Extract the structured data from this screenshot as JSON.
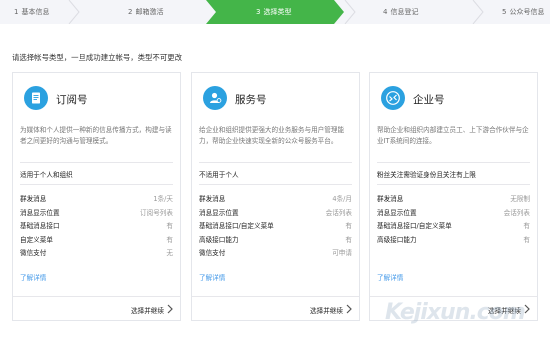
{
  "steps": [
    {
      "num": "1",
      "label": "基本信息"
    },
    {
      "num": "2",
      "label": "邮箱激活"
    },
    {
      "num": "3",
      "label": "选择类型"
    },
    {
      "num": "4",
      "label": "信息登记"
    },
    {
      "num": "5",
      "label": "公众号信息"
    }
  ],
  "intro": "请选择帐号类型，一旦成功建立帐号，类型不可更改",
  "cards": [
    {
      "title": "订阅号",
      "desc": "为媒体和个人提供一种新的信息传播方式，构建与读者之间更好的沟通与管理模式。",
      "scope": "适用于个人和组织",
      "features": [
        {
          "name": "群发消息",
          "value": "1条/天"
        },
        {
          "name": "消息显示位置",
          "value": "订阅号列表"
        },
        {
          "name": "基础消息接口",
          "value": "有"
        },
        {
          "name": "自定义菜单",
          "value": "有"
        },
        {
          "name": "微信支付",
          "value": "无"
        }
      ],
      "more": "了解详情",
      "choose": "选择并继续"
    },
    {
      "title": "服务号",
      "desc": "给企业和组织提供更强大的业务服务与用户管理能力，帮助企业快速实现全新的公众号服务平台。",
      "scope": "不适用于个人",
      "features": [
        {
          "name": "群发消息",
          "value": "4条/月"
        },
        {
          "name": "消息显示位置",
          "value": "会话列表"
        },
        {
          "name": "基础消息接口/自定义菜单",
          "value": "有"
        },
        {
          "name": "高级接口能力",
          "value": "有"
        },
        {
          "name": "微信支付",
          "value": "可申请"
        }
      ],
      "more": "了解详情",
      "choose": "选择并继续"
    },
    {
      "title": "企业号",
      "desc": "帮助企业和组织内部建立员工、上下游合作伙伴与企业IT系统间的连接。",
      "scope": "粉丝关注需验证身份且关注有上限",
      "features": [
        {
          "name": "群发消息",
          "value": "无限制"
        },
        {
          "name": "消息显示位置",
          "value": "会话列表"
        },
        {
          "name": "基础消息接口/自定义菜单",
          "value": "有"
        },
        {
          "name": "高级接口能力",
          "value": "有"
        }
      ],
      "more": "了解详情",
      "choose": "选择并继续"
    }
  ],
  "watermark": "Kejixun.com",
  "colors": {
    "accent": "#44b549",
    "icon": "#2ba1e0",
    "link": "#459ae9"
  }
}
